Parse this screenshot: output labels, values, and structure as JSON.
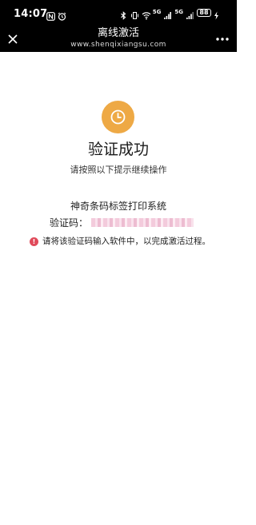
{
  "status_bar": {
    "time": "14:07",
    "battery": "88",
    "network_5g_a": "5G",
    "network_5g_b": "5G"
  },
  "title_bar": {
    "title": "离线激活",
    "subtitle": "www.shenqixiangsu.com"
  },
  "icons": {
    "close": "close-icon",
    "more": "more-icon",
    "status": "clock-icon"
  },
  "colors": {
    "accent": "#eea945",
    "warning": "#e04a5a",
    "bar_bg": "#000000"
  },
  "main": {
    "heading": "验证成功",
    "hint": "请按照以下提示继续操作",
    "product_name": "神奇条码标签打印系统",
    "code_label": "验证码：",
    "warning_text": "请将该验证码输入软件中，以完成激活过程。"
  }
}
